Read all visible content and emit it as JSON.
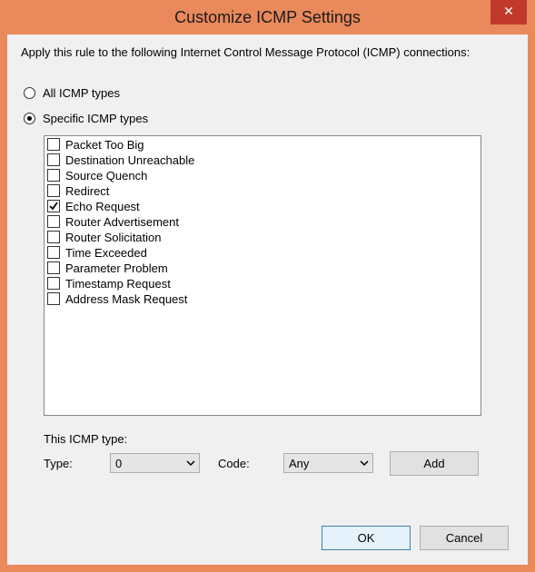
{
  "window": {
    "title": "Customize ICMP Settings",
    "close_glyph": "✕"
  },
  "intro_text": "Apply this rule to the following Internet Control Message Protocol (ICMP) connections:",
  "radios": [
    {
      "label": "All ICMP types",
      "selected": false
    },
    {
      "label": "Specific ICMP types",
      "selected": true
    }
  ],
  "icmp_types": [
    {
      "label": "Packet Too Big",
      "checked": false
    },
    {
      "label": "Destination Unreachable",
      "checked": false
    },
    {
      "label": "Source Quench",
      "checked": false
    },
    {
      "label": "Redirect",
      "checked": false
    },
    {
      "label": "Echo Request",
      "checked": true
    },
    {
      "label": "Router Advertisement",
      "checked": false
    },
    {
      "label": "Router Solicitation",
      "checked": false
    },
    {
      "label": "Time Exceeded",
      "checked": false
    },
    {
      "label": "Parameter Problem",
      "checked": false
    },
    {
      "label": "Timestamp Request",
      "checked": false
    },
    {
      "label": "Address Mask Request",
      "checked": false
    }
  ],
  "this_type": {
    "heading": "This ICMP type:",
    "type_label": "Type:",
    "type_value": "0",
    "code_label": "Code:",
    "code_value": "Any",
    "add_label": "Add"
  },
  "footer": {
    "ok_label": "OK",
    "cancel_label": "Cancel"
  },
  "colors": {
    "frame": "#E9895C",
    "close": "#C0392B",
    "client": "#F0F0F0"
  },
  "icons": {
    "close": "close-icon",
    "checkmark": "checkmark-icon",
    "dropdown": "chevron-down-icon"
  }
}
